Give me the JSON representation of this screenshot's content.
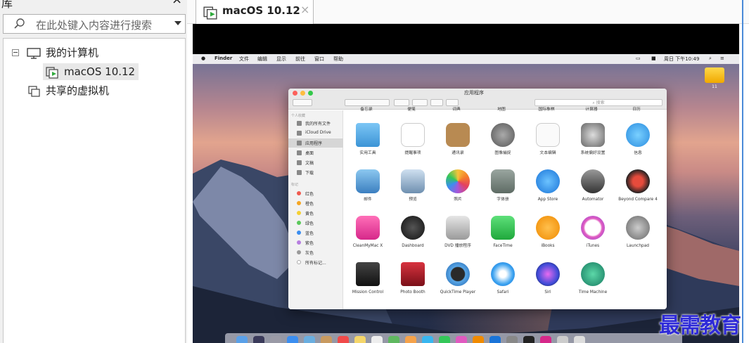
{
  "library": {
    "title": "库",
    "close_icon": "close-icon",
    "search_placeholder": "在此处键入内容进行搜索",
    "tree": {
      "my_computer": "我的计算机",
      "vm": "macOS 10.12",
      "shared": "共享的虚拟机"
    }
  },
  "tabs": [
    {
      "label": "macOS 10.12",
      "close": "×"
    }
  ],
  "mac": {
    "menubar": {
      "apple": "",
      "items": [
        "Finder",
        "文件",
        "编辑",
        "显示",
        "前往",
        "窗口",
        "帮助"
      ],
      "clock": "周日 下午10:49"
    },
    "finder": {
      "title": "应用程序",
      "search_placeholder": "搜索",
      "sidebar": {
        "section_favorites": "个人收藏",
        "favorites": [
          "我的所有文件",
          "iCloud Drive",
          "应用程序",
          "桌面",
          "文稿",
          "下载"
        ],
        "section_tags": "标记",
        "tags": [
          {
            "label": "红色",
            "color": "#f05a4f"
          },
          {
            "label": "橙色",
            "color": "#f5a623"
          },
          {
            "label": "黄色",
            "color": "#f5d033"
          },
          {
            "label": "绿色",
            "color": "#5ac85a"
          },
          {
            "label": "蓝色",
            "color": "#3b8ef0"
          },
          {
            "label": "紫色",
            "color": "#b77ee0"
          },
          {
            "label": "灰色",
            "color": "#9a9a9a"
          },
          {
            "label": "所有标记...",
            "color": "#ffffff"
          }
        ]
      },
      "cut_row": [
        "备忘录",
        "便笺",
        "词典",
        "地图",
        "国际象棋",
        "计算器",
        "日历"
      ],
      "apps": [
        [
          "实用工具",
          "提醒事项",
          "通讯录",
          "图像捕捉",
          "文本编辑",
          "系统偏好设置",
          "信息"
        ],
        [
          "邮件",
          "预览",
          "照片",
          "字体册",
          "App Store",
          "Automator",
          "Beyond Compare 4"
        ],
        [
          "CleanMyMac X",
          "Dashboard",
          "DVD 播放程序",
          "FaceTime",
          "iBooks",
          "iTunes",
          "Launchpad"
        ],
        [
          "Mission Control",
          "Photo Booth",
          "QuickTime Player",
          "Safari",
          "Siri",
          "Time Machine"
        ]
      ]
    },
    "desktop_drive_label": "11"
  },
  "watermark": "最需教育"
}
